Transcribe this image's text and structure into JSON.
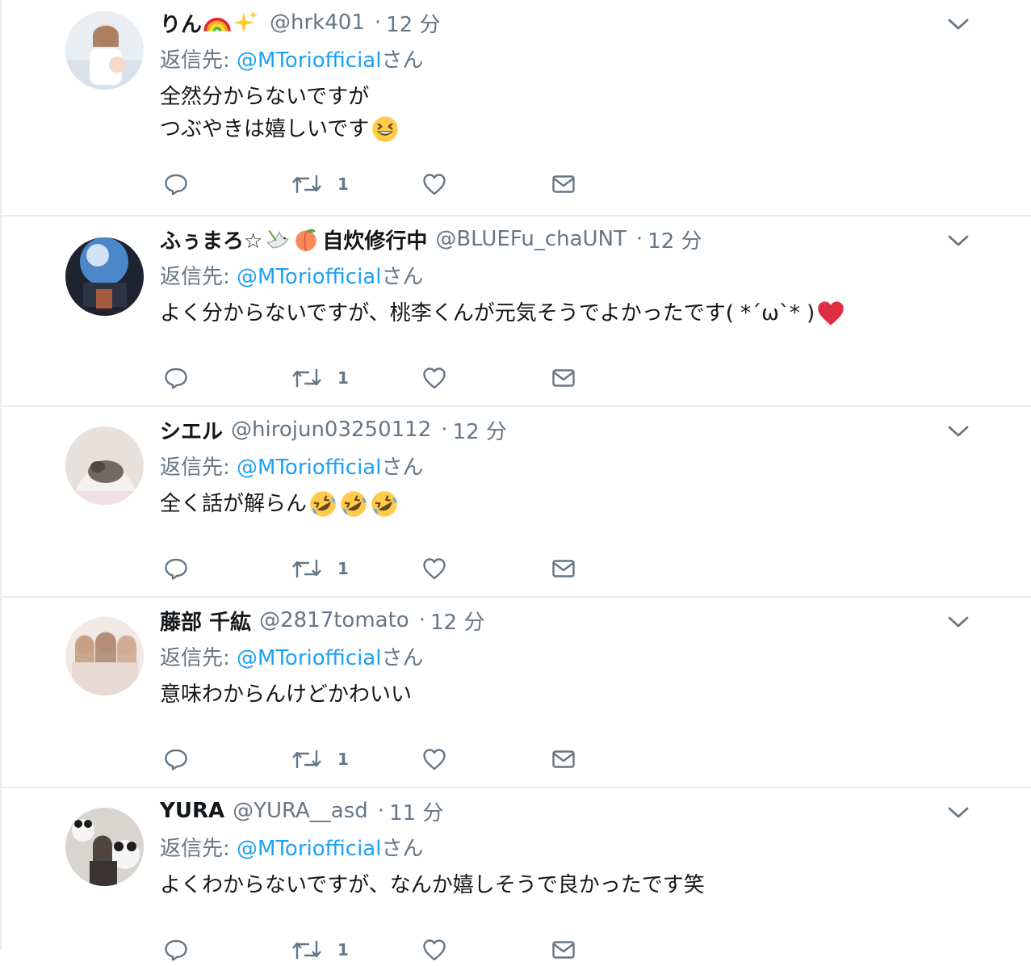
{
  "reply_prefix": "返信先: ",
  "reply_suffix": "さん",
  "colors": {
    "link": "#1da1f2",
    "secondary_text": "#657786",
    "primary_text": "#14171a",
    "divider": "#e6ecf0"
  },
  "tweets": [
    {
      "display_name": "りん",
      "name_emojis": [
        "rainbow-emoji",
        "sparkles-emoji"
      ],
      "handle": "@hrk401",
      "separator": "·",
      "time": "12 分",
      "reply_to": "@MToriofficial",
      "body_lines": [
        "全然分からないですが",
        "つぶやきは嬉しいです"
      ],
      "body_emojis": [
        "grinning-squinting-face-emoji"
      ],
      "retweet_count": "1",
      "like_count": ""
    },
    {
      "display_name": "ふぅまろ☆",
      "name_emojis": [
        "dove-emoji",
        "peach-emoji"
      ],
      "display_name_suffix": "自炊修行中",
      "handle": "@BLUEFu_chaUNT",
      "separator": "·",
      "time": "12 分",
      "reply_to": "@MToriofficial",
      "body_lines": [
        "よく分からないですが、桃李くんが元気そうでよかったです( *´ω`* )"
      ],
      "body_emojis": [
        "red-heart-emoji"
      ],
      "retweet_count": "1",
      "like_count": ""
    },
    {
      "display_name": "シエル",
      "name_emojis": [],
      "handle": "@hirojun03250112",
      "separator": "·",
      "time": "12 分",
      "reply_to": "@MToriofficial",
      "body_lines": [
        "全く話が解らん"
      ],
      "body_emojis": [
        "rolling-on-floor-laughing-emoji",
        "rolling-on-floor-laughing-emoji",
        "rolling-on-floor-laughing-emoji"
      ],
      "retweet_count": "1",
      "like_count": ""
    },
    {
      "display_name": "藤部 千紘",
      "name_emojis": [],
      "handle": "@2817tomato",
      "separator": "·",
      "time": "12 分",
      "reply_to": "@MToriofficial",
      "body_lines": [
        "意味わからんけどかわいい"
      ],
      "body_emojis": [],
      "retweet_count": "1",
      "like_count": ""
    },
    {
      "display_name": "YURA",
      "name_emojis": [],
      "handle": "@YURA__asd",
      "separator": "·",
      "time": "11 分",
      "reply_to": "@MToriofficial",
      "body_lines": [
        "よくわからないですが、なんか嬉しそうで良かったです笑"
      ],
      "body_emojis": [],
      "retweet_count": "1",
      "like_count": ""
    }
  ]
}
